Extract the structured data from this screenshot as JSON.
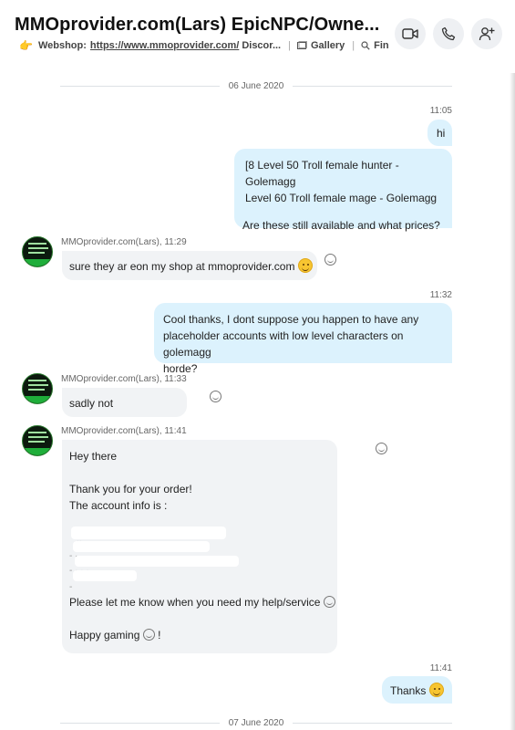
{
  "header": {
    "title": "MMOprovider.com(Lars) EpicNPC/Owne...",
    "mood_emoji": "👉",
    "mood_label": "Webshop:",
    "mood_link": "https://www.mmoprovider.com/",
    "mood_rest": "Discor...",
    "gallery_label": "Gallery",
    "find_label": "Find",
    "status_color": "#4bc24b"
  },
  "messages": {
    "date1": "06 June 2020",
    "t1": "11:05",
    "m1": "hi",
    "m2_l1": "[8 Level 50 Troll female hunter - Golemagg",
    "m2_l2": "Level 60 Troll female mage - Golemagg",
    "m2_l3": "Are these still available and what prices?",
    "s1": "MMOprovider.com(Lars), 11:29",
    "m3": "sure they ar eon my shop at mmoprovider.com",
    "t2": "11:32",
    "m4_l1": "Cool thanks, I dont suppose you happen to have any",
    "m4_l2": "placeholder accounts with low level characters on golemagg",
    "m4_l3": "horde?",
    "s2": "MMOprovider.com(Lars), 11:33",
    "m5": "sadly not",
    "s3": "MMOprovider.com(Lars), 11:41",
    "m6_l1": "Hey there",
    "m6_l2": "Thank you for your order!",
    "m6_l3": "The account info is :",
    "m6_l4": "Please let me know when you need my help/service",
    "m6_l5": "Happy gaming",
    "m6_l5_end": "!",
    "t3": "11:41",
    "m7": "Thanks",
    "date2": "07 June 2020"
  },
  "colors": {
    "outgoing_bubble": "#dcf2fd",
    "incoming_bubble": "#f1f3f5"
  }
}
